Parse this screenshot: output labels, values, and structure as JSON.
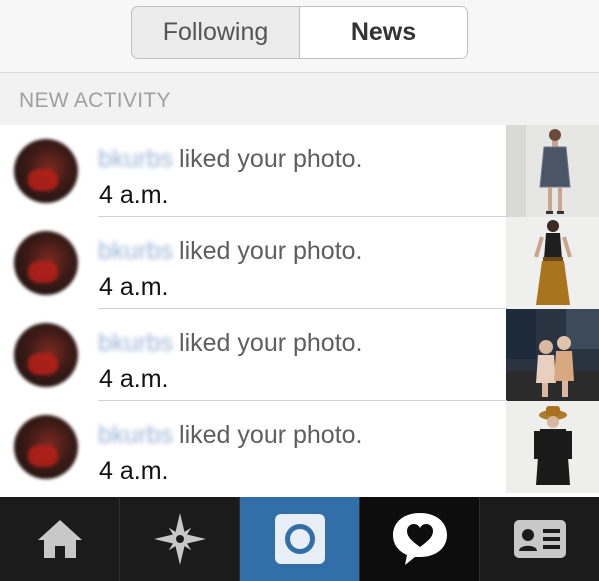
{
  "tabs": {
    "following": "Following",
    "news": "News",
    "active": "News"
  },
  "section_header": "NEW ACTIVITY",
  "activity": [
    {
      "username": "bkurbs",
      "action": "liked your photo.",
      "time": "4 a.m."
    },
    {
      "username": "bkurbs",
      "action": "liked your photo.",
      "time": "4 a.m."
    },
    {
      "username": "bkurbs",
      "action": "liked your photo.",
      "time": "4 a.m."
    },
    {
      "username": "bkurbs",
      "action": "liked your photo.",
      "time": "4 a.m."
    }
  ],
  "tabbar": [
    "home-icon",
    "explore-icon",
    "camera-icon",
    "news-icon",
    "profile-icon"
  ],
  "colors": {
    "camera_tab": "#326ea8",
    "tabbar": "#1e1e1e",
    "username": "#9db5d8"
  }
}
